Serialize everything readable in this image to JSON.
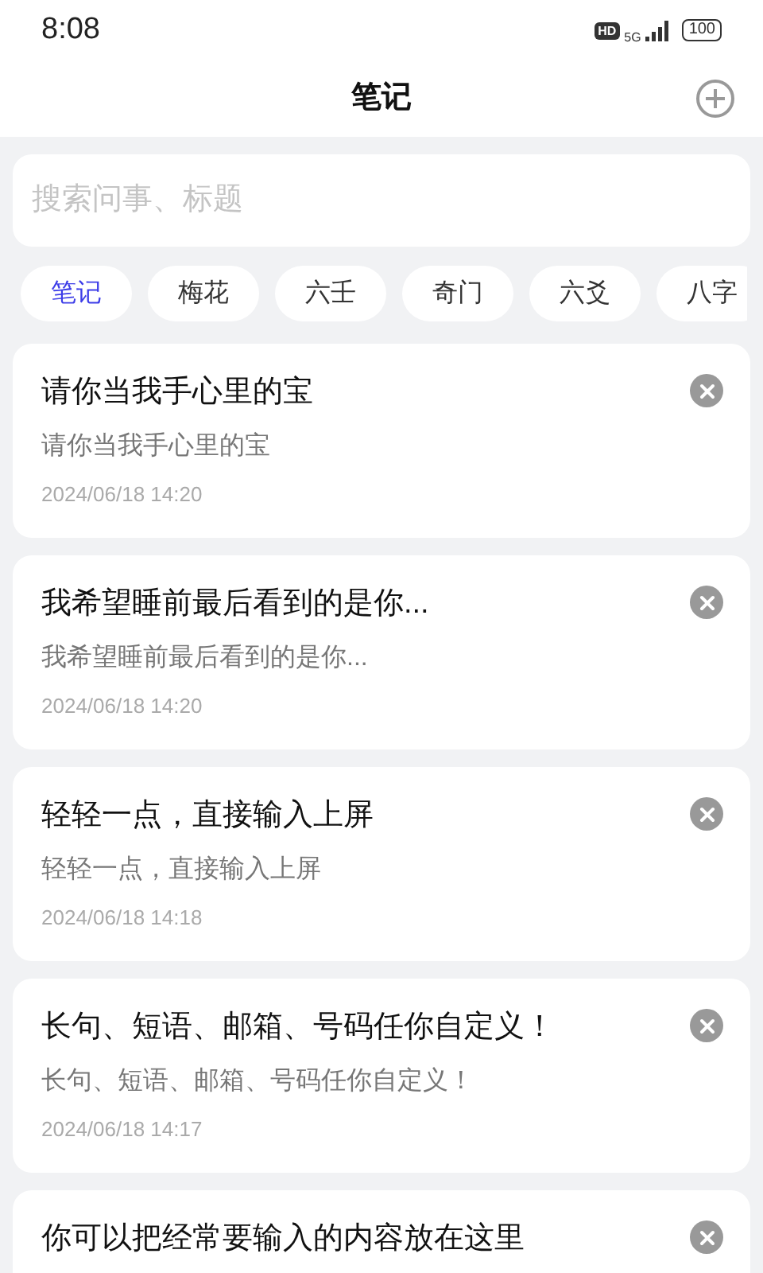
{
  "status_bar": {
    "time": "8:08",
    "hd": "HD",
    "network": "5G",
    "battery": "100"
  },
  "header": {
    "title": "笔记"
  },
  "search": {
    "placeholder": "搜索问事、标题"
  },
  "tabs": [
    {
      "label": "笔记",
      "selected": true
    },
    {
      "label": "梅花",
      "selected": false
    },
    {
      "label": "六壬",
      "selected": false
    },
    {
      "label": "奇门",
      "selected": false
    },
    {
      "label": "六爻",
      "selected": false
    },
    {
      "label": "八字",
      "selected": false
    }
  ],
  "notes": [
    {
      "title": "请你当我手心里的宝",
      "body": "请你当我手心里的宝",
      "date": "2024/06/18 14:20"
    },
    {
      "title": "我希望睡前最后看到的是你...",
      "body": "我希望睡前最后看到的是你...",
      "date": "2024/06/18 14:20"
    },
    {
      "title": "轻轻一点，直接输入上屏",
      "body": "轻轻一点，直接输入上屏",
      "date": "2024/06/18 14:18"
    },
    {
      "title": "长句、短语、邮箱、号码任你自定义！",
      "body": "长句、短语、邮箱、号码任你自定义！",
      "date": "2024/06/18 14:17"
    },
    {
      "title": "你可以把经常要输入的内容放在这里"
    }
  ]
}
